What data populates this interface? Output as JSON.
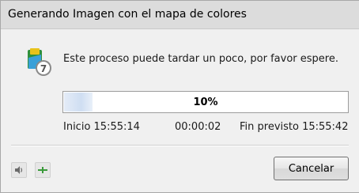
{
  "window": {
    "title": "Generando Imagen con el mapa de colores"
  },
  "message": "Este proceso puede tardar un poco, por favor espere.",
  "progress": {
    "percent": 10,
    "label": "10%"
  },
  "timing": {
    "start": "Inicio 15:55:14",
    "elapsed": "00:00:02",
    "end": "Fin previsto 15:55:42"
  },
  "buttons": {
    "cancel_label": "Cancelar"
  },
  "icons": {
    "app": "map-app-icon",
    "sound": "speaker-icon",
    "pin": "pin-icon"
  },
  "colors": {
    "progress_fill": "#cfdef2",
    "pin": "#3a9a3a"
  }
}
